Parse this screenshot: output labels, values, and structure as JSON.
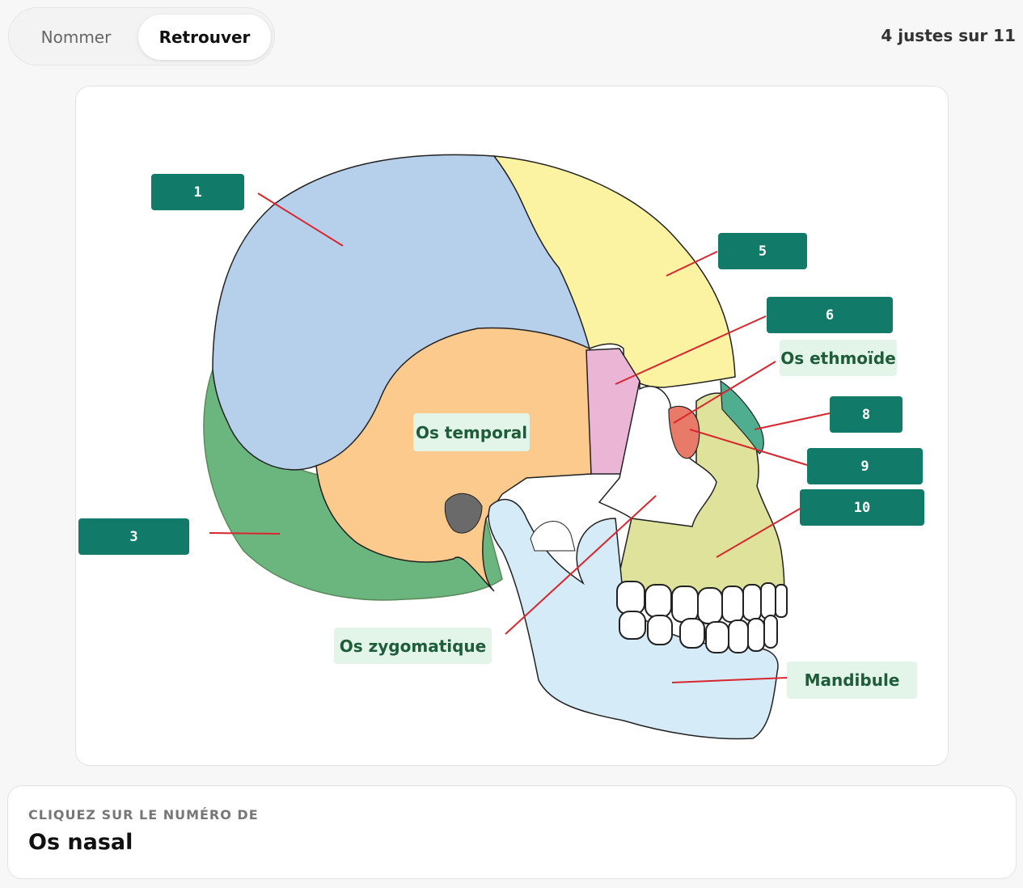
{
  "mode_toggle": {
    "options": [
      "Nommer",
      "Retrouver"
    ],
    "selected": "Retrouver"
  },
  "score": "4 justes sur 11",
  "markers": {
    "m1": "1",
    "m3": "3",
    "m5": "5",
    "m6": "6",
    "m8": "8",
    "m9": "9",
    "m10": "10"
  },
  "labels": {
    "ethmoide": "Os ethmoïde",
    "temporal": "Os temporal",
    "zygomatique": "Os zygomatique",
    "mandibule": "Mandibule"
  },
  "prompt": {
    "instruction": "CLIQUEZ SUR LE NUMÉRO DE",
    "target": "Os nasal"
  },
  "colors": {
    "accent": "#127a68",
    "answered_bg": "#e3f4e8",
    "leader_line": "#d9262e",
    "parietal": "#b6cfea",
    "frontal": "#fbf3a2",
    "occipital": "#6bb57f",
    "temporal": "#fcca8d",
    "sphenoid": "#ebb6d6",
    "zygomatic": "#ffffff",
    "maxilla": "#dfe29a",
    "mandible": "#d5ebf8",
    "nasal": "#4fae8f",
    "lacrimal": "#e87a6a"
  }
}
